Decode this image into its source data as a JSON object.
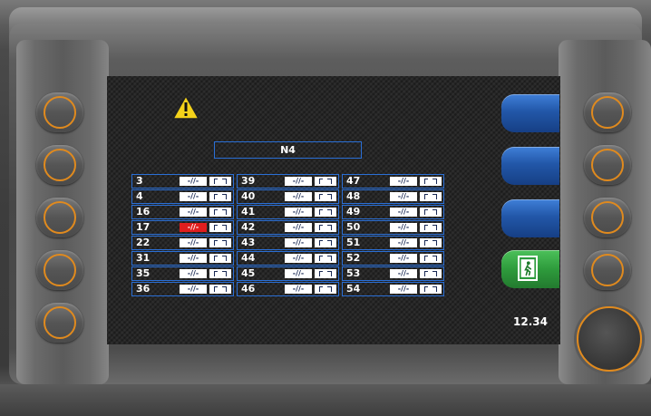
{
  "panel": {
    "title": "N4",
    "time": "12.34",
    "warning_icon": "warning-triangle-icon",
    "exit_icon": "emergency-exit-icon"
  },
  "switch_symbol": "-//-",
  "columns": [
    [
      {
        "num": "3",
        "alarm": false
      },
      {
        "num": "4",
        "alarm": false
      },
      {
        "num": "16",
        "alarm": false
      },
      {
        "num": "17",
        "alarm": true
      },
      {
        "num": "22",
        "alarm": false
      },
      {
        "num": "31",
        "alarm": false
      },
      {
        "num": "35",
        "alarm": false
      },
      {
        "num": "36",
        "alarm": false
      }
    ],
    [
      {
        "num": "39",
        "alarm": false
      },
      {
        "num": "40",
        "alarm": false
      },
      {
        "num": "41",
        "alarm": false
      },
      {
        "num": "42",
        "alarm": false
      },
      {
        "num": "43",
        "alarm": false
      },
      {
        "num": "44",
        "alarm": false
      },
      {
        "num": "45",
        "alarm": false
      },
      {
        "num": "46",
        "alarm": false
      }
    ],
    [
      {
        "num": "47",
        "alarm": false
      },
      {
        "num": "48",
        "alarm": false
      },
      {
        "num": "49",
        "alarm": false
      },
      {
        "num": "50",
        "alarm": false
      },
      {
        "num": "51",
        "alarm": false
      },
      {
        "num": "52",
        "alarm": false
      },
      {
        "num": "53",
        "alarm": false
      },
      {
        "num": "54",
        "alarm": false
      }
    ]
  ],
  "colors": {
    "border_blue": "#2a6fd6",
    "alarm_red": "#e01e1e",
    "accent_orange": "#e08a1e",
    "softkey_blue": "#2257a8",
    "exit_green": "#2e9b3c"
  }
}
